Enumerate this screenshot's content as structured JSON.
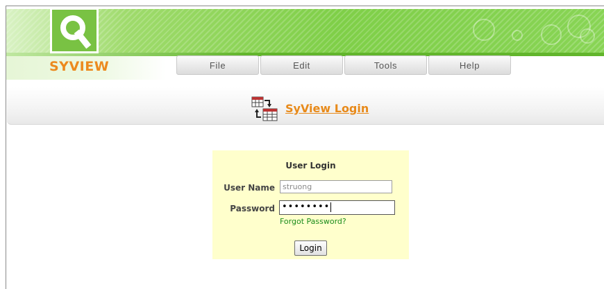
{
  "header": {
    "logo_text": "SYVIEW",
    "logo_icon": "magnifier-icon",
    "brand_colors": {
      "green": "#7fcf48",
      "orange": "#ec8a1e"
    }
  },
  "menu": {
    "items": [
      {
        "label": "File"
      },
      {
        "label": "Edit"
      },
      {
        "label": "Tools"
      },
      {
        "label": "Help"
      }
    ]
  },
  "page": {
    "title": "SyView Login",
    "title_icon": "table-transfer-icon"
  },
  "login": {
    "heading": "User Login",
    "username_label": "User Name",
    "username_value": "struong",
    "password_label": "Password",
    "password_masked": "••••••••",
    "forgot_link": "Forgot Password?",
    "submit_label": "Login",
    "panel_color": "#ffffcc",
    "link_color": "#1a8c1a"
  }
}
